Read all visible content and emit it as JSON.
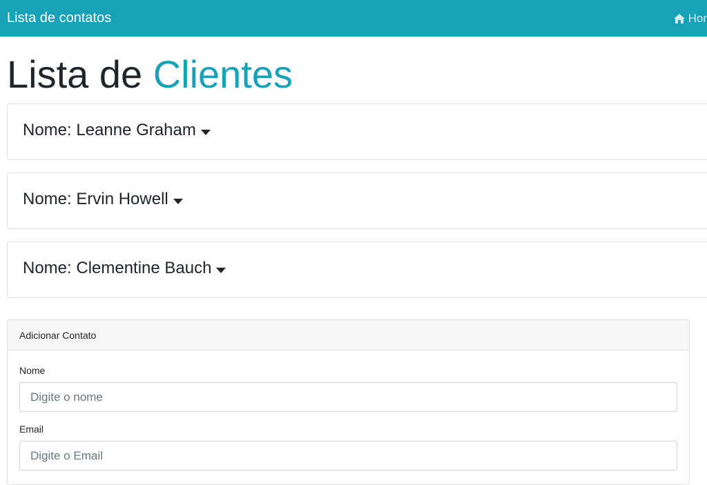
{
  "navbar": {
    "brand": "Lista de contatos",
    "home_label": "Home",
    "background": "#17a2b8"
  },
  "page_title": {
    "main": "Lista de",
    "accent": "Clientes",
    "accent_color": "#17a2b8"
  },
  "contacts": [
    {
      "label": "Nome: Leanne Graham"
    },
    {
      "label": "Nome: Ervin Howell"
    },
    {
      "label": "Nome: Clementine Bauch"
    }
  ],
  "add_form": {
    "header": "Adicionar Contato",
    "name_label": "Nome",
    "name_placeholder": "Digite o nome",
    "email_label": "Email",
    "email_placeholder": "Digite o Email"
  }
}
